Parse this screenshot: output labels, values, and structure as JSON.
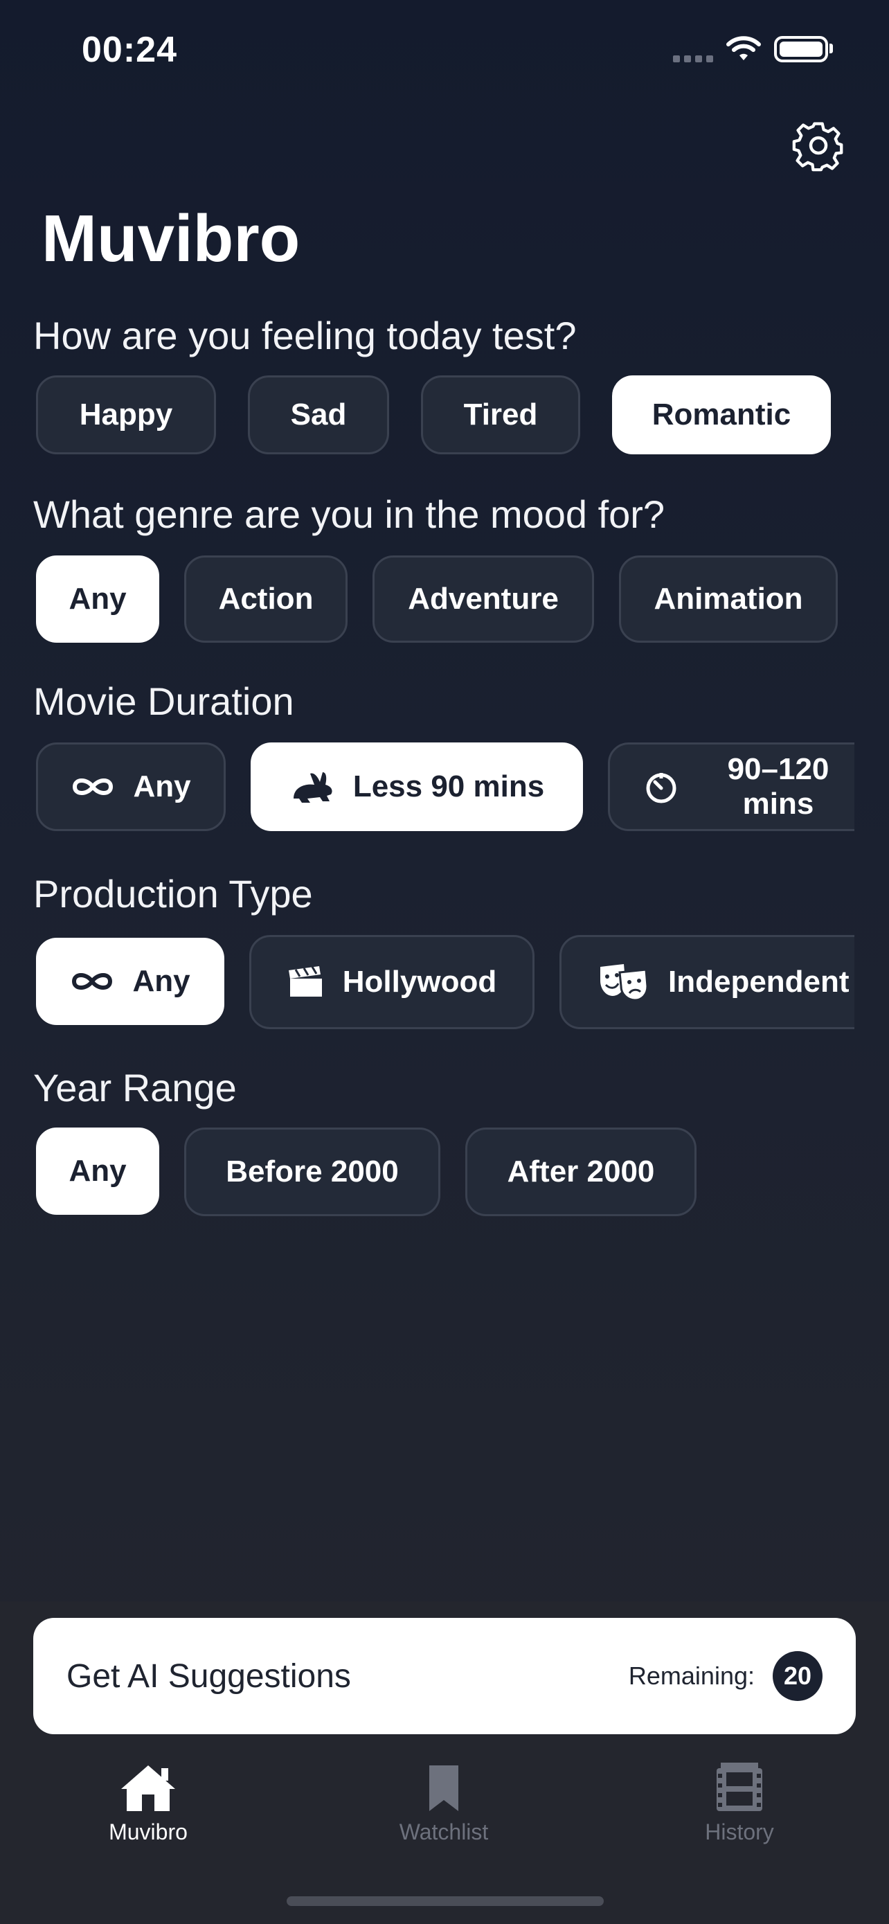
{
  "status_bar": {
    "time": "00:24"
  },
  "app": {
    "title": "Muvibro"
  },
  "mood": {
    "label": "How are you feeling today test?",
    "options": [
      "Happy",
      "Sad",
      "Tired",
      "Romantic"
    ],
    "selected": "Romantic"
  },
  "genre": {
    "label": "What genre are you in the mood for?",
    "options": [
      "Any",
      "Action",
      "Adventure",
      "Animation"
    ],
    "selected": "Any"
  },
  "duration": {
    "label": "Movie Duration",
    "options": [
      {
        "label": "Any",
        "icon": "infinity-icon"
      },
      {
        "label": "Less 90 mins",
        "icon": "rabbit-icon"
      },
      {
        "label": "90–120 mins",
        "icon": "timer-icon"
      }
    ],
    "selected": "Less 90 mins"
  },
  "production": {
    "label": "Production Type",
    "options": [
      {
        "label": "Any",
        "icon": "infinity-icon"
      },
      {
        "label": "Hollywood",
        "icon": "clapperboard-icon"
      },
      {
        "label": "Independent",
        "icon": "theater-masks-icon"
      }
    ],
    "selected": "Any"
  },
  "year": {
    "label": "Year Range",
    "options": [
      "Any",
      "Before 2000",
      "After 2000"
    ],
    "selected": "Any"
  },
  "cta": {
    "label": "Get AI Suggestions",
    "remaining_label": "Remaining:",
    "remaining_count": "20"
  },
  "tabs": [
    {
      "label": "Muvibro",
      "icon": "house-icon",
      "active": true
    },
    {
      "label": "Watchlist",
      "icon": "bookmark-icon",
      "active": false
    },
    {
      "label": "History",
      "icon": "film-icon",
      "active": false
    }
  ],
  "colors": {
    "background_top": "#141b2d",
    "background_bottom": "#24262e",
    "pill_bg": "#232a38",
    "pill_border": "#3a4150",
    "selected_bg": "#ffffff",
    "selected_text": "#1b2130"
  }
}
